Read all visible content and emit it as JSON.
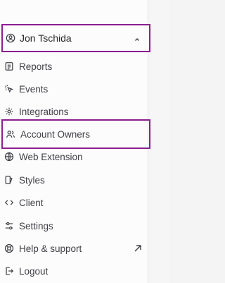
{
  "user": {
    "name": "Jon Tschida"
  },
  "menu": {
    "items": [
      {
        "label": "Reports",
        "icon": "reports-icon"
      },
      {
        "label": "Events",
        "icon": "cursor-click-icon"
      },
      {
        "label": "Integrations",
        "icon": "gear-icon"
      },
      {
        "label": "Account Owners",
        "icon": "users-icon"
      },
      {
        "label": "Web Extension",
        "icon": "globe-icon"
      },
      {
        "label": "Styles",
        "icon": "paint-icon"
      },
      {
        "label": "Client",
        "icon": "code-icon"
      },
      {
        "label": "Settings",
        "icon": "sliders-icon"
      },
      {
        "label": "Help & support",
        "icon": "lifebuoy-icon"
      },
      {
        "label": "Logout",
        "icon": "logout-icon"
      }
    ]
  },
  "colors": {
    "highlight_border": "#8b1f8f",
    "text": "#3f3f46"
  }
}
